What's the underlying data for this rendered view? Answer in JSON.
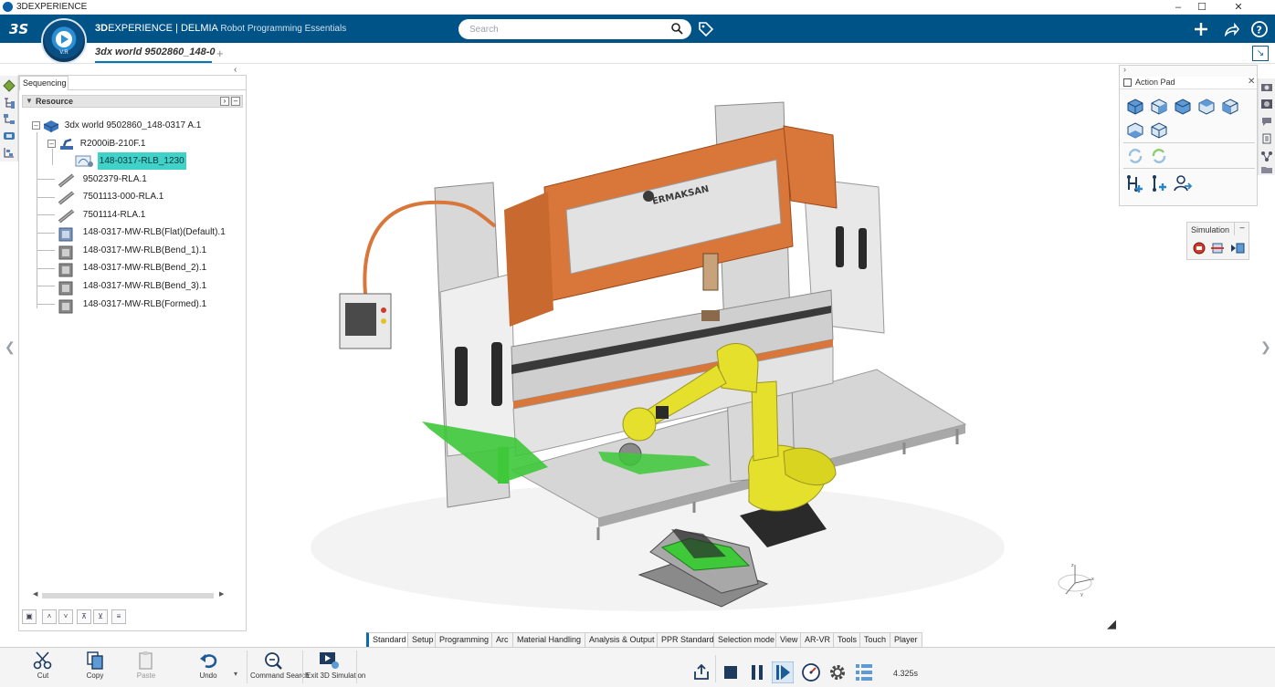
{
  "os": {
    "title": "3DEXPERIENCE"
  },
  "header": {
    "brand_prefix": "3D",
    "brand_rest": "EXPERIENCE | DELMIA",
    "subtitle": "Robot Programming Essentials",
    "compass_label": "V.R",
    "search_placeholder": "Search"
  },
  "tabs": {
    "document": "3dx world 9502860_148-0",
    "add": "+"
  },
  "left_panel": {
    "tab": "Sequencing",
    "header": "Resource",
    "tree": [
      {
        "label": "3dx world 9502860_148-0317 A.1",
        "icon": "world-icon"
      },
      {
        "label": "R2000iB-210F.1",
        "icon": "robot-icon"
      },
      {
        "label": "148-0317-RLB_1230",
        "icon": "program-icon"
      },
      {
        "label": "9502379-RLA.1",
        "icon": "tool-icon"
      },
      {
        "label": "7501113-000-RLA.1",
        "icon": "tool-icon"
      },
      {
        "label": "7501114-RLA.1",
        "icon": "tool-icon"
      },
      {
        "label": "148-0317-MW-RLB(Flat)(Default).1",
        "icon": "part-icon"
      },
      {
        "label": "148-0317-MW-RLB(Bend_1).1",
        "icon": "part-icon"
      },
      {
        "label": "148-0317-MW-RLB(Bend_2).1",
        "icon": "part-icon"
      },
      {
        "label": "148-0317-MW-RLB(Bend_3).1",
        "icon": "part-icon"
      },
      {
        "label": "148-0317-MW-RLB(Formed).1",
        "icon": "part-icon"
      }
    ]
  },
  "action_pad": {
    "title": "Action Pad"
  },
  "simulation_toolbar": {
    "title": "Simulation"
  },
  "viewport": {
    "brand_label": "ERMAKSAN"
  },
  "section_tabs": [
    "Standard",
    "Setup",
    "Programming",
    "Arc",
    "Material Handling",
    "Analysis & Output",
    "PPR Standard",
    "Selection mode",
    "View",
    "AR-VR",
    "Tools",
    "Touch",
    "Player"
  ],
  "bottom_toolbar": {
    "cut": "Cut",
    "copy": "Copy",
    "paste": "Paste",
    "undo": "Undo",
    "command_search": "Command Search",
    "exit_sim": "Exit 3D Simulation"
  },
  "player": {
    "time": "4.325s"
  },
  "colors": {
    "header": "#005386",
    "accent": "#0b6aa8",
    "selection": "#40d2c8",
    "machine_orange": "#d9763a",
    "robot_yellow": "#e5e02c",
    "part_green": "#3ec83a"
  }
}
